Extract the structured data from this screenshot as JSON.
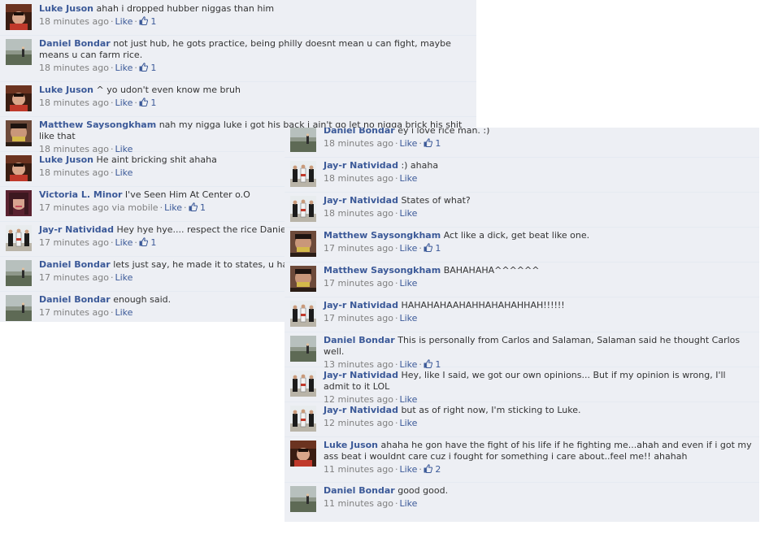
{
  "left_panel": {
    "comments": [
      {
        "name": "Luke Juson",
        "text": "ahah i dropped hubber niggas than him",
        "time": "18 minutes ago",
        "like_label": "Like",
        "likes": "1",
        "avatar": "luke-avatar"
      },
      {
        "name": "Daniel Bondar",
        "text": "not just hub, he gots practice, being philly doesnt mean u can fight, maybe means u can farm rice.",
        "time": "18 minutes ago",
        "like_label": "Like",
        "likes": "1",
        "avatar": "daniel-avatar"
      },
      {
        "name": "Luke Juson",
        "text": "^ yo udon't even know me bruh",
        "time": "18 minutes ago",
        "like_label": "Like",
        "likes": "1",
        "avatar": "luke-avatar"
      },
      {
        "name": "Matthew Saysongkham",
        "text": "nah my nigga luke i got his back i ain't go let no nigga brick his shit like that",
        "time": "18 minutes ago",
        "like_label": "Like",
        "likes": "",
        "avatar": "matthew-avatar"
      },
      {
        "name": "Luke Juson",
        "text": "He aint bricking shit ahaha",
        "time": "18 minutes ago",
        "like_label": "Like",
        "likes": "",
        "avatar": "luke-avatar"
      },
      {
        "name": "Victoria L. Minor",
        "text": "I've Seen Him At Center o.O",
        "time": "17 minutes ago via mobile",
        "like_label": "Like",
        "likes": "1",
        "avatar": "victoria-avatar"
      },
      {
        "name": "Jay-r Natividad",
        "text": "Hey hye hye.... respect the rice Daniel LOL",
        "time": "17 minutes ago",
        "like_label": "Like",
        "likes": "1",
        "avatar": "jayr-avatar"
      },
      {
        "name": "Daniel Bondar",
        "text": "lets just say, he made it to states, u havent",
        "time": "17 minutes ago",
        "like_label": "Like",
        "likes": "",
        "avatar": "daniel-avatar"
      },
      {
        "name": "Daniel Bondar",
        "text": "enough said.",
        "time": "17 minutes ago",
        "like_label": "Like",
        "likes": "",
        "avatar": "daniel-avatar"
      }
    ]
  },
  "right_panel": {
    "comments": [
      {
        "name": "Daniel Bondar",
        "text": "ey i love rice man. :)",
        "time": "18 minutes ago",
        "like_label": "Like",
        "likes": "1",
        "avatar": "daniel-avatar"
      },
      {
        "name": "Jay-r Natividad",
        "text": ":) ahaha",
        "time": "18 minutes ago",
        "like_label": "Like",
        "likes": "",
        "avatar": "jayr-avatar"
      },
      {
        "name": "Jay-r Natividad",
        "text": "States of what?",
        "time": "18 minutes ago",
        "like_label": "Like",
        "likes": "",
        "avatar": "jayr-avatar"
      },
      {
        "name": "Matthew Saysongkham",
        "text": "Act like a dick, get beat like one.",
        "time": "17 minutes ago",
        "like_label": "Like",
        "likes": "1",
        "avatar": "matthew-avatar"
      },
      {
        "name": "Matthew Saysongkham",
        "text": "BAHAHAHA^^^^^^",
        "time": "17 minutes ago",
        "like_label": "Like",
        "likes": "",
        "avatar": "matthew-avatar"
      },
      {
        "name": "Jay-r Natividad",
        "text": "HAHAHAHAAHAHHAHAHAHHAH!!!!!!",
        "time": "17 minutes ago",
        "like_label": "Like",
        "likes": "",
        "avatar": "jayr-avatar"
      },
      {
        "name": "Daniel Bondar",
        "text": "This is personally from Carlos and Salaman, Salaman said he thought Carlos well.",
        "time": "13 minutes ago",
        "like_label": "Like",
        "likes": "1",
        "avatar": "daniel-avatar"
      },
      {
        "name": "Jay-r Natividad",
        "text": "Hey, like I said, we got our own opinions... But if my opinion is wrong, I'll admit to it LOL",
        "time": "12 minutes ago",
        "like_label": "Like",
        "likes": "",
        "avatar": "jayr-avatar"
      },
      {
        "name": "Jay-r Natividad",
        "text": "but as of right now, I'm sticking to Luke.",
        "time": "12 minutes ago",
        "like_label": "Like",
        "likes": "",
        "avatar": "jayr-avatar"
      },
      {
        "name": "Luke Juson",
        "text": "ahaha he gon have the fight of his life if he fighting me...ahah and even if i got my ass beat i wouldnt care cuz i fought for something i care about..feel me!! ahahah",
        "time": "11 minutes ago",
        "like_label": "Like",
        "likes": "2",
        "avatar": "luke-avatar"
      },
      {
        "name": "Daniel Bondar",
        "text": "good good.",
        "time": "11 minutes ago",
        "like_label": "Like",
        "likes": "",
        "avatar": "daniel-avatar"
      }
    ]
  },
  "colors": {
    "panel_bg": "#edeff4",
    "name": "#3b5998",
    "meta": "#808080",
    "divider": "#e5eaf1"
  }
}
